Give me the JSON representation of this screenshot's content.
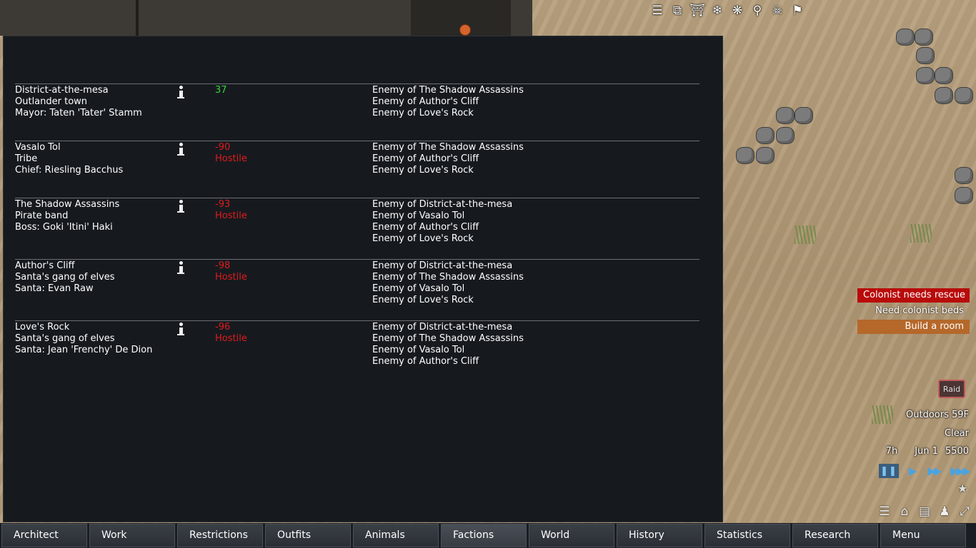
{
  "factions": [
    {
      "name": "District-at-the-mesa",
      "type": "Outlander town",
      "leader": "Mayor: Taten 'Tater' Stamm",
      "goodwill": "37",
      "status": "",
      "relations": [
        "Enemy of The Shadow Assassins",
        "Enemy of Author's Cliff",
        "Enemy of Love's Rock"
      ]
    },
    {
      "name": "Vasalo Tol",
      "type": "Tribe",
      "leader": "Chief: Riesling Bacchus",
      "goodwill": "-90",
      "status": "Hostile",
      "relations": [
        "Enemy of The Shadow Assassins",
        "Enemy of Author's Cliff",
        "Enemy of Love's Rock"
      ]
    },
    {
      "name": "The Shadow Assassins",
      "type": "Pirate band",
      "leader": "Boss: Goki 'Itini' Haki",
      "goodwill": "-93",
      "status": "Hostile",
      "relations": [
        "Enemy of District-at-the-mesa",
        "Enemy of Vasalo Tol",
        "Enemy of Author's Cliff",
        "Enemy of Love's Rock"
      ]
    },
    {
      "name": "Author's Cliff",
      "type": "Santa's gang of elves",
      "leader": "Santa: Evan Raw",
      "goodwill": "-98",
      "status": "Hostile",
      "relations": [
        "Enemy of District-at-the-mesa",
        "Enemy of The Shadow Assassins",
        "Enemy of Vasalo Tol",
        "Enemy of Love's Rock"
      ]
    },
    {
      "name": "Love's Rock",
      "type": "Santa's gang of elves",
      "leader": "Santa: Jean 'Frenchy' De Dion",
      "goodwill": "-96",
      "status": "Hostile",
      "relations": [
        "Enemy of District-at-the-mesa",
        "Enemy of The Shadow Assassins",
        "Enemy of Vasalo Tol",
        "Enemy of Author's Cliff"
      ]
    }
  ],
  "alerts": {
    "rescue": "Colonist needs rescue",
    "beds": "Need colonist beds",
    "room": "Build a room"
  },
  "raid_label": "Raid",
  "weather": {
    "temperature": "Outdoors 59F",
    "condition": "Clear"
  },
  "date": {
    "hour": "7h",
    "day": "Jun 1",
    "year": "5500"
  },
  "colors": {
    "goodwill_positive": "#37d43a",
    "goodwill_negative": "#e01b1b",
    "alert_critical": "#b90b0b",
    "alert_warning": "#b5682a"
  },
  "tabs": [
    "Architect",
    "Work",
    "Restrictions",
    "Outfits",
    "Animals",
    "Factions",
    "World",
    "History",
    "Statistics",
    "Research",
    "Menu"
  ],
  "active_tab": "Factions"
}
